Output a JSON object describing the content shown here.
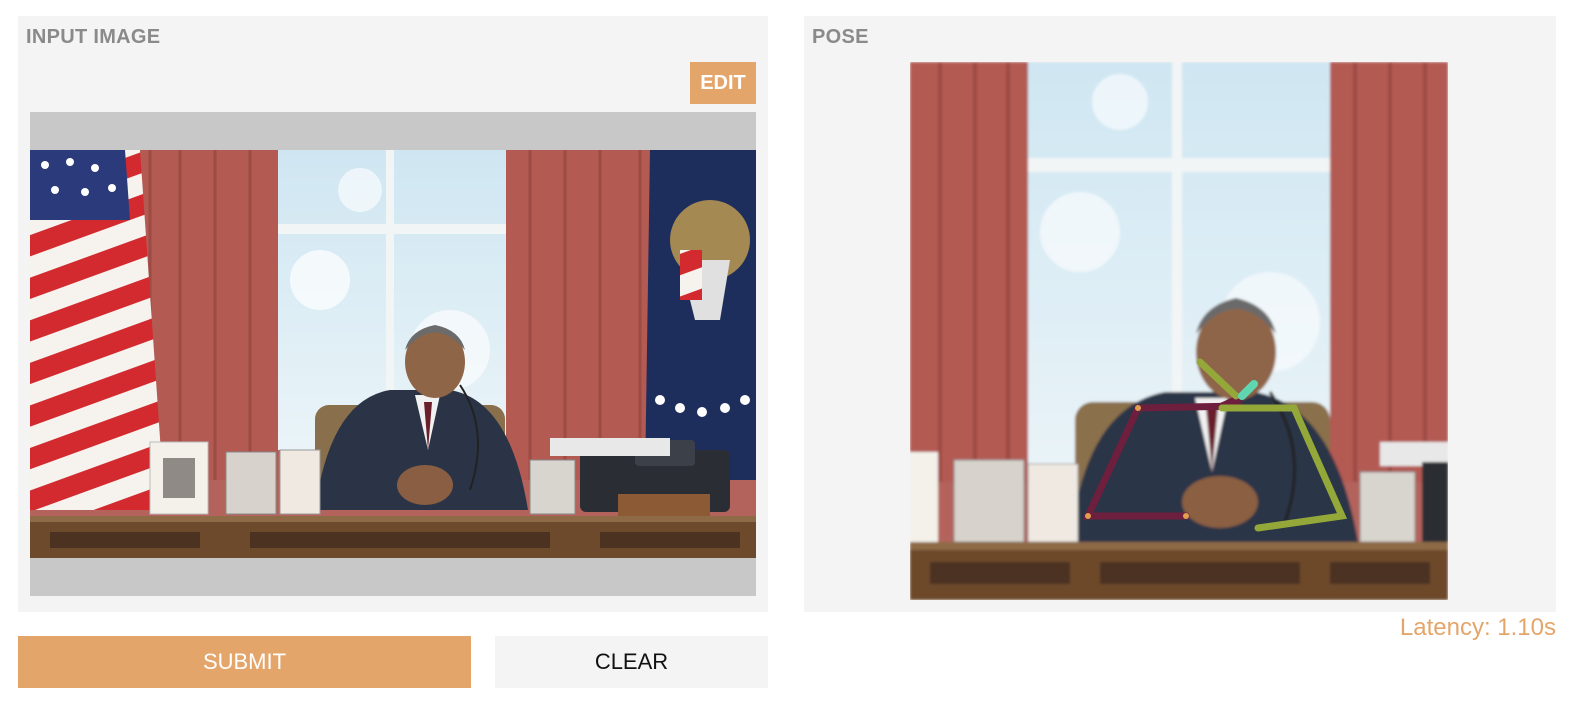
{
  "input_panel": {
    "title": "INPUT IMAGE",
    "edit_label": "EDIT"
  },
  "pose_panel": {
    "title": "POSE"
  },
  "actions": {
    "submit_label": "SUBMIT",
    "clear_label": "CLEAR"
  },
  "latency": "Latency: 1.10s",
  "colors": {
    "accent": "#e4a56a",
    "panel_bg": "#f4f4f4",
    "pose_left_limbs": "#6e1f3e",
    "pose_right_limbs": "#94a83a",
    "pose_face": "#5fd6b0"
  },
  "input_image": {
    "content": "photo-man-at-desk-with-flags"
  },
  "pose_image": {
    "content": "photo-man-at-desk-with-pose-skeleton-overlay"
  }
}
